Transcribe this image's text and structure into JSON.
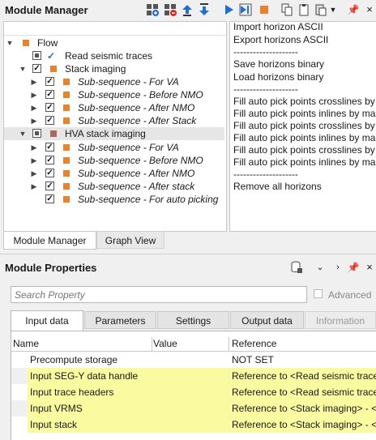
{
  "module_manager": {
    "title": "Module Manager",
    "toolbar_icons": [
      "add-module-icon",
      "remove-module-icon",
      "move-up-icon",
      "move-down-icon",
      "run-icon",
      "run-step-icon",
      "stop-icon",
      "copy-icon",
      "clipboard-icon",
      "paste-icon",
      "dropdown-icon",
      "pin-icon",
      "close-icon"
    ]
  },
  "tree": [
    {
      "label": "Flow",
      "color": "#e8822c"
    },
    {
      "label": "Read seismic traces",
      "color": "#1f6fd1"
    },
    {
      "label": "Stack imaging",
      "color": "#e8822c"
    },
    {
      "label": "Sub-sequence - For VA",
      "color": "#e8822c"
    },
    {
      "label": "Sub-sequence - Before NMO",
      "color": "#e8822c"
    },
    {
      "label": "Sub-sequence - After NMO",
      "color": "#e8822c"
    },
    {
      "label": "Sub-sequence - After Stack",
      "color": "#e8822c"
    },
    {
      "label": "HVA stack imaging",
      "color": "#a86a5a"
    },
    {
      "label": "Sub-sequence - For VA",
      "color": "#e8822c"
    },
    {
      "label": "Sub-sequence - Before NMO",
      "color": "#e8822c"
    },
    {
      "label": "Sub-sequence - After NMO",
      "color": "#e8822c"
    },
    {
      "label": "Sub-sequence - After stack",
      "color": "#e8822c"
    },
    {
      "label": "Sub-sequence - For auto picking",
      "color": "#e8822c"
    }
  ],
  "menu_items": [
    "Import horizon ASCII",
    "Export horizons ASCII",
    "--------------------",
    "Save horizons binary",
    "Load horizons binary",
    "--------------------",
    "Fill auto pick points crosslines by",
    "Fill auto pick points inlines by ma",
    "Fill auto pick points crosslines by",
    "Fill auto pick points inlines by ma",
    "Fill auto pick points crosslines by",
    "Fill auto pick points inlines by ma",
    "--------------------",
    "Remove all horizons"
  ],
  "bottom_tabs": [
    "Module Manager",
    "Graph View"
  ],
  "module_properties": {
    "title": "Module Properties",
    "search_placeholder": "Search Property",
    "advanced_label": "Advanced",
    "tabs": [
      "Input data",
      "Parameters",
      "Settings",
      "Output data",
      "Information"
    ],
    "columns": [
      "Name",
      "Value",
      "Reference"
    ],
    "rows": [
      {
        "name": "Precompute storage",
        "value": "",
        "reference": "NOT SET",
        "highlight": false
      },
      {
        "name": "Input SEG-Y data handle",
        "value": "",
        "reference": "Reference to <Read seismic traces",
        "highlight": true
      },
      {
        "name": "Input trace headers",
        "value": "",
        "reference": "Reference to <Read seismic traces",
        "highlight": true
      },
      {
        "name": "Input VRMS",
        "value": "",
        "reference": "Reference to <Stack imaging> - <",
        "highlight": true
      },
      {
        "name": "Input stack",
        "value": "",
        "reference": "Reference to <Stack imaging> - <",
        "highlight": true
      }
    ]
  },
  "colors": {
    "highlight": "#fafaa0",
    "accent": "#1f6fd1",
    "orange": "#e8822c"
  }
}
